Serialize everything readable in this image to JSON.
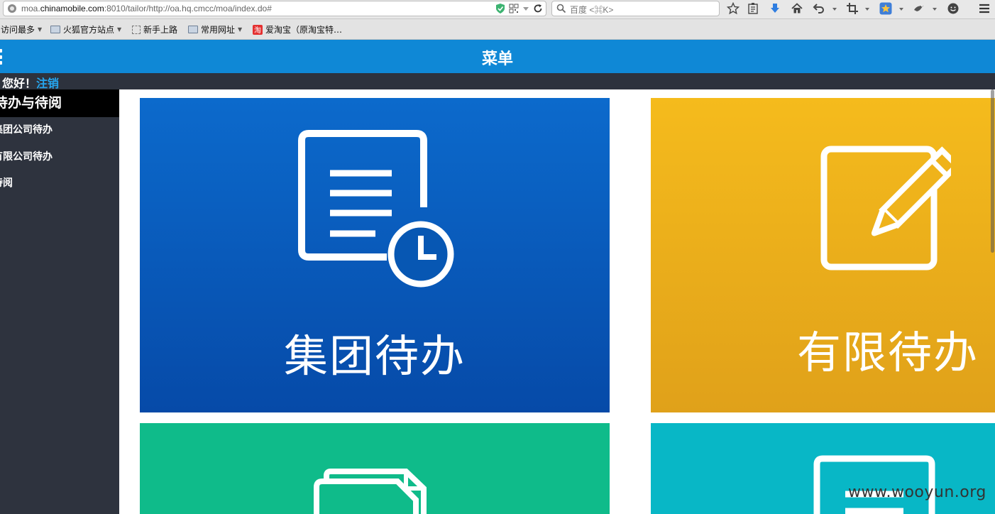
{
  "browser": {
    "url_prefix": "moa.",
    "url_domain": "chinamobile.com",
    "url_rest": ":8010/tailor/http://oa.hq.cmcc/moa/index.do#",
    "search_placeholder": "百度 <⌘K>"
  },
  "bookmarks": [
    {
      "label": "访问最多",
      "icon": "folder-dropdown"
    },
    {
      "label": "火狐官方站点",
      "icon": "folder-icon"
    },
    {
      "label": "新手上路",
      "icon": "dashed-page-icon"
    },
    {
      "label": "常用网址",
      "icon": "folder-icon"
    },
    {
      "label": "爱淘宝（原淘宝特…",
      "icon": "taobao-icon",
      "icon_text": "淘"
    }
  ],
  "header": {
    "title": "菜单",
    "greeting": "您好！",
    "logout": "注销"
  },
  "sidebar": {
    "heading": "待办与待阅",
    "items": [
      {
        "label": "集团公司待办"
      },
      {
        "label": "有限公司待办"
      },
      {
        "label": "待阅"
      }
    ]
  },
  "tiles": [
    {
      "label": "集团待办",
      "icon": "document-clock-icon",
      "color": "#0a5fbf"
    },
    {
      "label": "有限待办",
      "icon": "edit-pencil-icon",
      "color": "#f0b41c"
    },
    {
      "label": "",
      "icon": "documents-icon",
      "color": "#0fbb8a"
    },
    {
      "label": "",
      "icon": "list-icon",
      "color": "#08b7c6"
    }
  ],
  "watermark": "www.wooyun.org"
}
